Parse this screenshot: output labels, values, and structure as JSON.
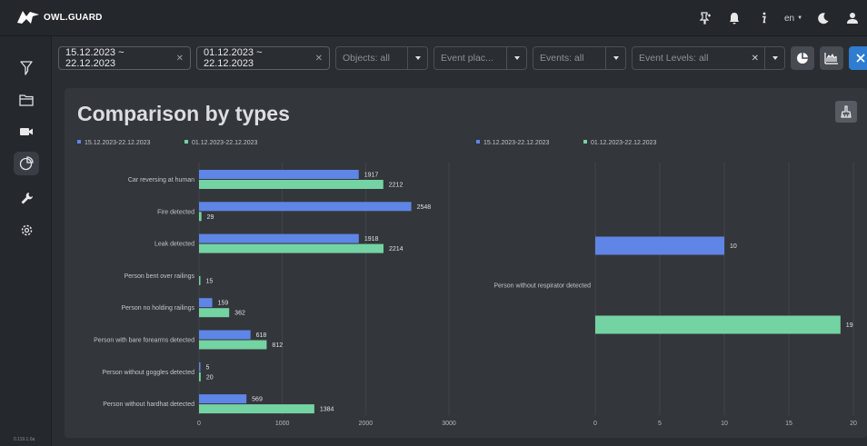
{
  "app": {
    "logo_text": "OWL.GUARD",
    "version": "0.119.1.0a"
  },
  "header": {
    "language": "en",
    "icons": [
      "pin-icon",
      "bell-icon",
      "info-icon",
      "moon-icon",
      "user-icon"
    ]
  },
  "sidebar": {
    "items": [
      {
        "name": "filter",
        "icon": "funnel-icon"
      },
      {
        "name": "events",
        "icon": "folder-icon"
      },
      {
        "name": "cameras",
        "icon": "camera-icon"
      },
      {
        "name": "statistics",
        "icon": "pie-chart-icon",
        "active": true
      },
      {
        "name": "tools",
        "icon": "wrench-icon"
      },
      {
        "name": "settings",
        "icon": "gear-icon"
      }
    ]
  },
  "filters": {
    "date_range_1": "15.12.2023 ~ 22.12.2023",
    "date_range_2": "01.12.2023 ~ 22.12.2023",
    "objects_placeholder": "Objects: all",
    "event_place_placeholder": "Event plac...",
    "events_placeholder": "Events: all",
    "event_levels_placeholder": "Event Levels: all"
  },
  "panel": {
    "title": "Comparison by types"
  },
  "colors": {
    "series1": "#5f86e6",
    "series2": "#74d3a3",
    "accent": "#2f7dd1"
  },
  "chart_data": [
    {
      "type": "bar",
      "orientation": "horizontal",
      "categories": [
        "Car reversing at human",
        "Fire detected",
        "Leak detected",
        "Person bent over railings",
        "Person no holding railings",
        "Person with bare forearms detected",
        "Person without goggles detected",
        "Person without hardhat detected"
      ],
      "series": [
        {
          "name": "15.12.2023-22.12.2023",
          "values": [
            1917,
            2548,
            1918,
            null,
            159,
            618,
            5,
            569
          ]
        },
        {
          "name": "01.12.2023-22.12.2023",
          "values": [
            2212,
            29,
            2214,
            15,
            362,
            812,
            20,
            1384
          ]
        }
      ],
      "x_ticks": [
        0,
        1000,
        2000,
        3000
      ],
      "xlim": [
        0,
        3000
      ],
      "legend": "top-left",
      "grid": true
    },
    {
      "type": "bar",
      "orientation": "horizontal",
      "categories": [
        "Person without respirator detected"
      ],
      "series": [
        {
          "name": "15.12.2023-22.12.2023",
          "values": [
            10
          ]
        },
        {
          "name": "01.12.2023-22.12.2023",
          "values": [
            19
          ]
        }
      ],
      "x_ticks": [
        0,
        5,
        10,
        15,
        20
      ],
      "xlim": [
        0,
        20
      ],
      "legend": "top-left",
      "grid": true
    }
  ]
}
